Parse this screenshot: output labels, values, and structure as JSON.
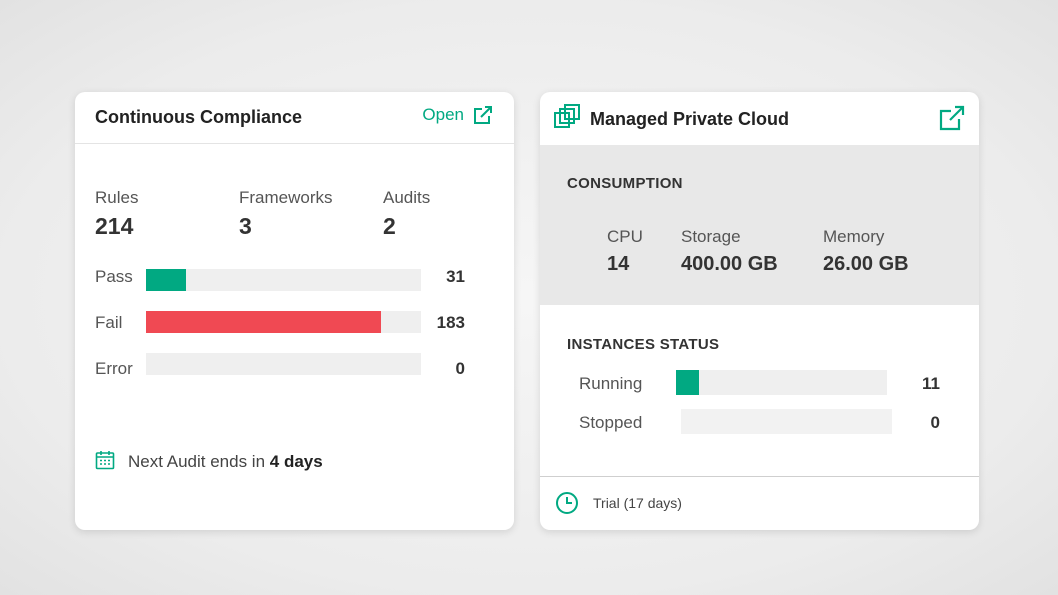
{
  "compliance": {
    "title": "Continuous Compliance",
    "open_label": "Open",
    "stats": [
      {
        "label": "Rules",
        "value": "214"
      },
      {
        "label": "Frameworks",
        "value": "3"
      },
      {
        "label": "Audits",
        "value": "2"
      }
    ],
    "bars": [
      {
        "label": "Pass",
        "count": "31",
        "fraction": 0.146,
        "color": "#01a982"
      },
      {
        "label": "Fail",
        "count": "183",
        "fraction": 0.855,
        "color": "#f04953"
      },
      {
        "label": "Error",
        "count": "0",
        "fraction": 0,
        "color": "#f04953"
      }
    ],
    "footer": {
      "prefix": "Next Audit ends in",
      "emphasis": "4 days",
      "icon": "calendar-icon"
    }
  },
  "cloud": {
    "title": "Managed Private Cloud",
    "consumption": {
      "heading": "CONSUMPTION",
      "items": [
        {
          "label": "CPU",
          "value": "14"
        },
        {
          "label": "Storage",
          "value": "400.00 GB"
        },
        {
          "label": "Memory",
          "value": "26.00 GB"
        }
      ]
    },
    "instances": {
      "heading": "INSTANCES STATUS",
      "bars": [
        {
          "label": "Running",
          "count": "11",
          "fraction": 0.11,
          "color": "#01a982"
        },
        {
          "label": "Stopped",
          "count": "0",
          "fraction": 0,
          "color": "#01a982"
        }
      ]
    },
    "footer": {
      "text": "Trial (17 days)",
      "icon": "clock-icon"
    }
  },
  "colors": {
    "accent": "#01a982",
    "danger": "#f04953"
  }
}
